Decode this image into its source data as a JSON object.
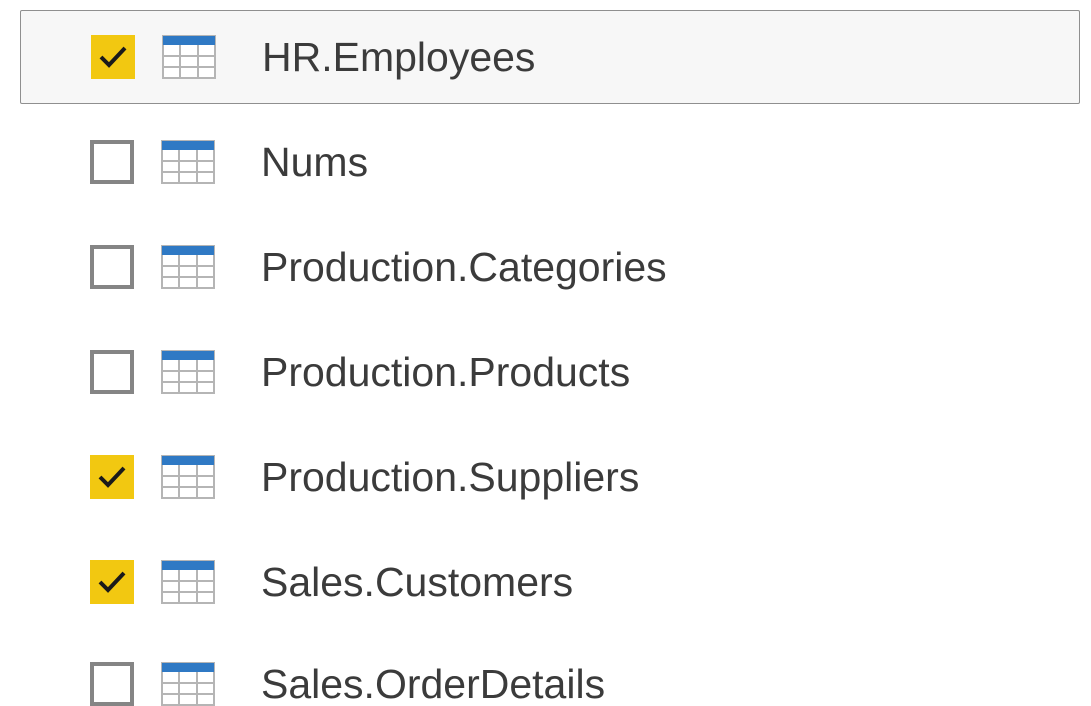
{
  "items": [
    {
      "label": "HR.Employees",
      "checked": true,
      "selected": true,
      "icon": "table-icon"
    },
    {
      "label": "Nums",
      "checked": false,
      "selected": false,
      "icon": "table-icon"
    },
    {
      "label": "Production.Categories",
      "checked": false,
      "selected": false,
      "icon": "table-icon"
    },
    {
      "label": "Production.Products",
      "checked": false,
      "selected": false,
      "icon": "table-icon"
    },
    {
      "label": "Production.Suppliers",
      "checked": true,
      "selected": false,
      "icon": "table-icon"
    },
    {
      "label": "Sales.Customers",
      "checked": true,
      "selected": false,
      "icon": "table-icon"
    },
    {
      "label": "Sales.OrderDetails",
      "checked": false,
      "selected": false,
      "icon": "table-icon"
    }
  ],
  "colors": {
    "checkbox_checked": "#f2c811",
    "checkbox_border": "#858585",
    "checkmark": "#1a1a1a",
    "table_header": "#2f79c4",
    "table_grid": "#b5b5b5",
    "text": "#3b3b3b",
    "selection_border": "#8f8f8f"
  }
}
